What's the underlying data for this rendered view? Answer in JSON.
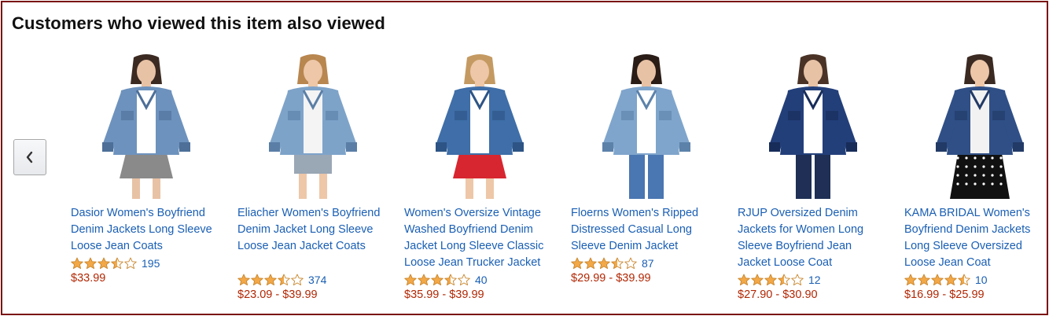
{
  "header": {
    "title": "Customers who viewed this item also viewed"
  },
  "nav": {
    "prev_icon": "chevron-left-icon"
  },
  "colors": {
    "link": "#1a5fb4",
    "price": "#b12704",
    "star": "#f3a847",
    "frame": "#7a1212"
  },
  "products": [
    {
      "name": "Dasior Women's Boyfriend Denim Jackets Long Sleeve Loose Jean Coats",
      "rating": 3.5,
      "reviews": "195",
      "price": "$33.99",
      "image": "denim-jacket-photo"
    },
    {
      "name": "Eliacher Women's Boyfriend Denim Jacket Long Sleeve Loose Jean Jacket Coats",
      "rating": 3.5,
      "reviews": "374",
      "price": "$23.09 - $39.99",
      "image": "denim-jacket-photo"
    },
    {
      "name": "Women's Oversize Vintage Washed Boyfriend Denim Jacket Long Sleeve Classic Loose Jean Trucker Jacket",
      "rating": 3.5,
      "reviews": "40",
      "price": "$35.99 - $39.99",
      "image": "denim-jacket-photo"
    },
    {
      "name": "Floerns Women's Ripped Distressed Casual Long Sleeve Denim Jacket",
      "rating": 3.5,
      "reviews": "87",
      "price": "$29.99 - $39.99",
      "image": "denim-jacket-photo"
    },
    {
      "name": "RJUP Oversized Denim Jackets for Women Long Sleeve Boyfriend Jean Jacket Loose Coat",
      "rating": 3.5,
      "reviews": "12",
      "price": "$27.90 - $30.90",
      "image": "denim-jacket-photo"
    },
    {
      "name": "KAMA BRIDAL Women's Boyfriend Denim Jackets Long Sleeve Oversized Loose Jean Coat",
      "rating": 4.5,
      "reviews": "10",
      "price": "$16.99 - $25.99",
      "image": "denim-jacket-photo"
    }
  ]
}
